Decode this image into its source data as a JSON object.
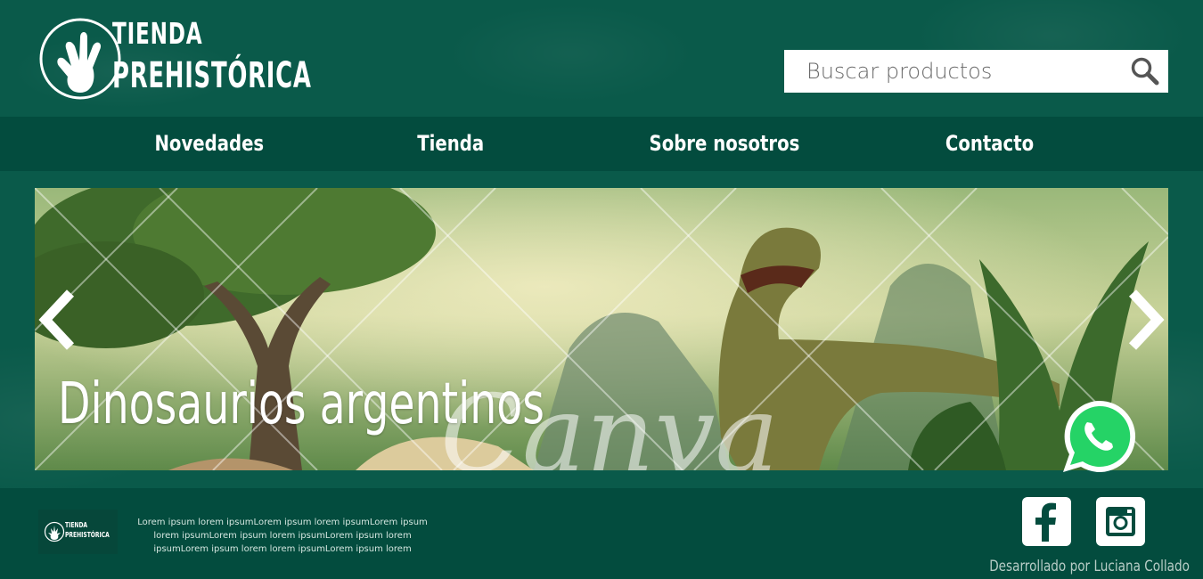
{
  "brand": {
    "line1": "TIENDA",
    "line2": "PREHISTÓRICA"
  },
  "search": {
    "placeholder": "Buscar productos",
    "icon": "magnifier-icon"
  },
  "nav": {
    "items": [
      {
        "label": "Novedades"
      },
      {
        "label": "Tienda"
      },
      {
        "label": "Sobre nosotros"
      },
      {
        "label": "Contacto"
      }
    ]
  },
  "slider": {
    "title": "Dinosaurios argentinos",
    "watermark": "Canva",
    "prev_icon": "chevron-left-icon",
    "next_icon": "chevron-right-icon"
  },
  "whatsapp": {
    "icon": "whatsapp-icon"
  },
  "footer": {
    "logo_line1": "TIENDA",
    "logo_line2": "PREHISTÓRICA",
    "text": "Lorem ipsum lorem ipsumLorem ipsum lorem ipsumLorem ipsum lorem ipsumLorem ipsum lorem ipsumLorem ipsum lorem ipsumLorem ipsum lorem lorem ipsumLorem ipsum lorem",
    "credit": "Desarrollado por Luciana Collado",
    "social": [
      {
        "icon": "facebook-icon"
      },
      {
        "icon": "instagram-icon"
      }
    ]
  },
  "colors": {
    "background": "#0a5a4a",
    "nav": "#034c3e",
    "footer": "#034c3e",
    "whatsapp": "#25D366"
  }
}
